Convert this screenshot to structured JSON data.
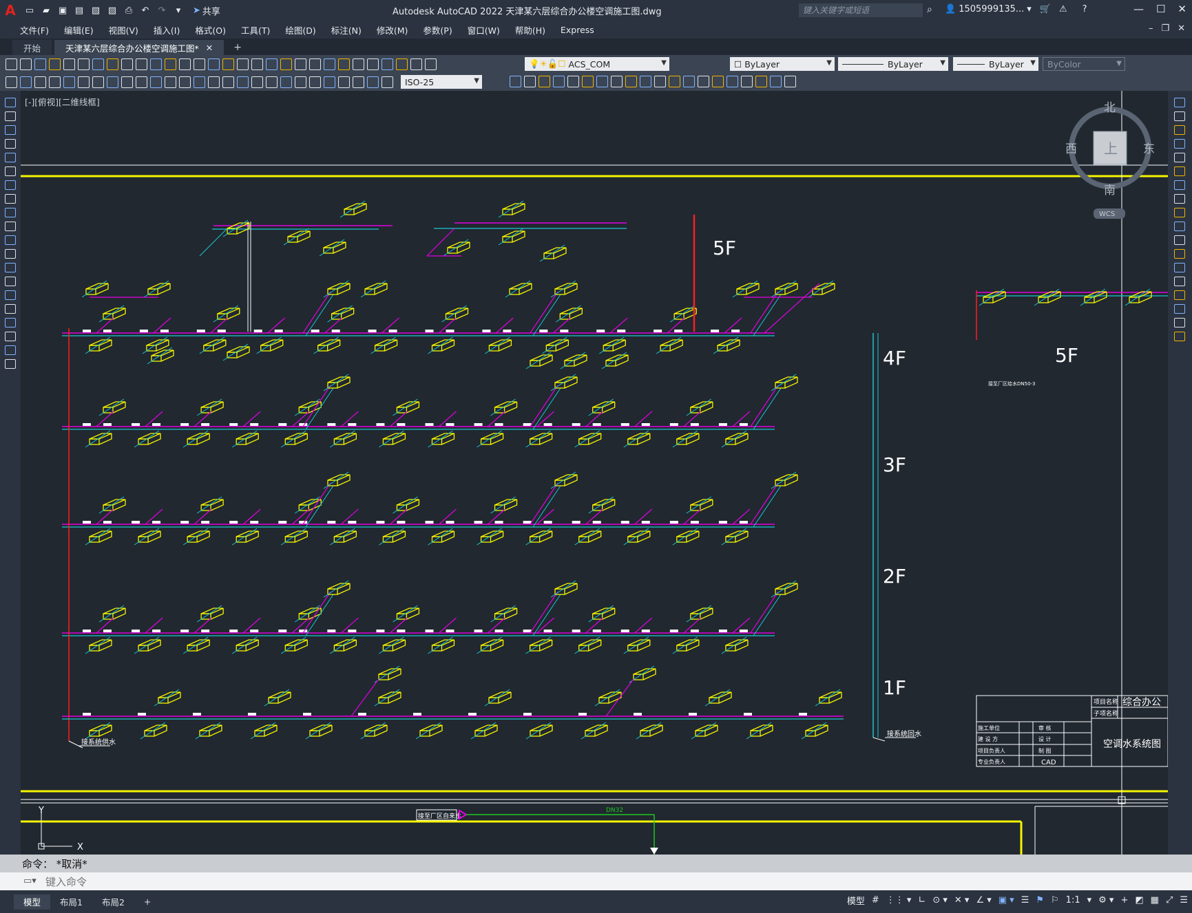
{
  "app": {
    "title": "Autodesk AutoCAD 2022    天津某六层综合办公楼空调施工图.dwg",
    "share_label": "共享",
    "search_placeholder": "键入关键字或短语",
    "user_name": "1505999135...",
    "logo_letter": "A"
  },
  "menu": [
    "文件(F)",
    "编辑(E)",
    "视图(V)",
    "插入(I)",
    "格式(O)",
    "工具(T)",
    "绘图(D)",
    "标注(N)",
    "修改(M)",
    "参数(P)",
    "窗口(W)",
    "帮助(H)",
    "Express"
  ],
  "tabs": [
    {
      "label": "开始"
    },
    {
      "label": "天津某六层综合办公楼空调施工图*"
    }
  ],
  "toolbar": {
    "layer_value": "ACS_COM",
    "color_value": "ByLayer",
    "linetype_value": "ByLayer",
    "lineweight_value": "ByLayer",
    "plotstyle_value": "ByColor",
    "dimstyle_value": "ISO-25"
  },
  "viewport": {
    "label": "[-][俯视][二维线框]",
    "viewcube_north": "北",
    "viewcube_south": "南",
    "viewcube_west": "西",
    "viewcube_east": "东",
    "viewcube_top": "上",
    "wcs": "WCS"
  },
  "drawing": {
    "floors": [
      "5F",
      "4F",
      "3F",
      "2F",
      "1F"
    ],
    "side_floor": "5F",
    "supply_label": "接系统供水",
    "return_label": "接系统回水",
    "lower_label": "接至厂区自来水",
    "lower_pipe": "DN32",
    "side_note": "接至厂区给水DN50-3",
    "titleblock": {
      "project_name_label": "项目名称",
      "sub_project_label": "子项名称",
      "project_name": "综合办公",
      "drawing_name": "空调水系统图",
      "rows": [
        [
          "施工单位",
          "审 核"
        ],
        [
          "建 设 方",
          "设 计"
        ],
        [
          "项目负责人",
          "制 图"
        ],
        [
          "专业负责人",
          "CAD"
        ]
      ]
    },
    "colors": {
      "yellow": "#f5f500",
      "magenta": "#e100e1",
      "cyan": "#18c8d2",
      "red": "#ff1e1e",
      "white": "#ffffff",
      "green": "#1ec81e"
    }
  },
  "command": {
    "history": "命令：  *取消*",
    "placeholder": "键入命令"
  },
  "layouts": [
    "模型",
    "布局1",
    "布局2"
  ],
  "status_bar": {
    "model_label": "模型",
    "scale": "1:1"
  }
}
